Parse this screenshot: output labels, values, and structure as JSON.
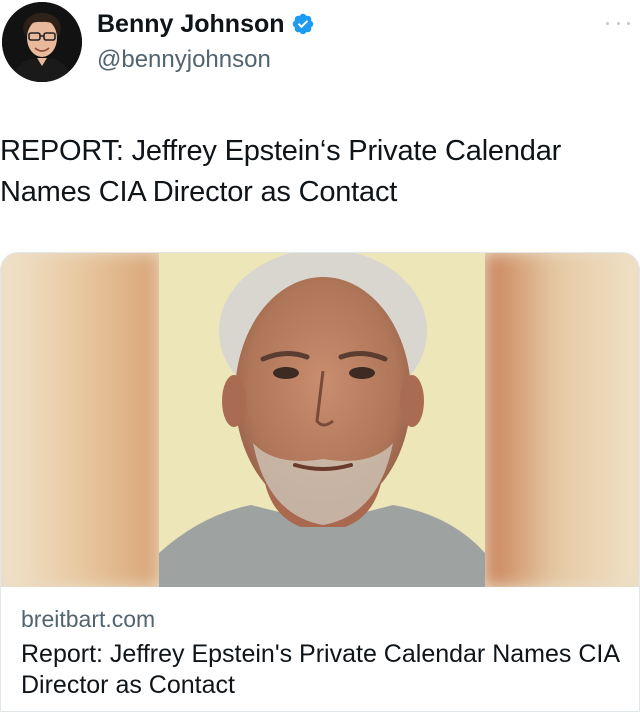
{
  "author": {
    "display_name": "Benny Johnson",
    "handle": "@bennyjohnson",
    "verified": true,
    "verified_color": "#1d9bf0"
  },
  "tweet": {
    "text": "REPORT: Jeffrey Epstein‘s Private Calendar Names CIA Director as Contact"
  },
  "card": {
    "domain": "breitbart.com",
    "title": "Report: Jeffrey Epstein's Private Calendar Names CIA Director as Contact"
  },
  "icons": {
    "verified": "verified-badge-icon",
    "more": "more-options-icon"
  }
}
